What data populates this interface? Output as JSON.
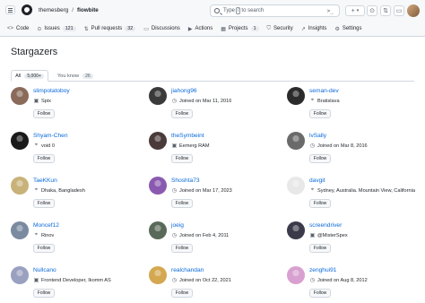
{
  "header": {
    "owner": "themesberg",
    "separator": "/",
    "repo": "flowbite",
    "search_placeholder_prefix": "Type",
    "search_key": "/",
    "search_placeholder_suffix": "to search",
    "command_icon": ">_",
    "plus_label": "+",
    "caret_label": "▾"
  },
  "tabs": [
    {
      "icon": "<>",
      "label": "Code",
      "count": ""
    },
    {
      "icon": "⊙",
      "label": "Issues",
      "count": "121"
    },
    {
      "icon": "⇅",
      "label": "Pull requests",
      "count": "32"
    },
    {
      "icon": "▭",
      "label": "Discussions",
      "count": ""
    },
    {
      "icon": "▶",
      "label": "Actions",
      "count": ""
    },
    {
      "icon": "▦",
      "label": "Projects",
      "count": "1"
    },
    {
      "icon": "⛉",
      "label": "Security",
      "count": ""
    },
    {
      "icon": "↗",
      "label": "Insights",
      "count": ""
    },
    {
      "icon": "⚙",
      "label": "Settings",
      "count": ""
    }
  ],
  "page": {
    "title": "Stargazers",
    "tab_all": "All",
    "tab_all_count": "5,000+",
    "tab_known": "You know",
    "tab_known_count": "26",
    "follow_label": "Follow"
  },
  "users": [
    {
      "name": "slimpotatoboy",
      "meta_icon": "▣",
      "meta": "Spix",
      "color": "#8a6a5a"
    },
    {
      "name": "jiahong96",
      "meta_icon": "◷",
      "meta": "Joined on Mar 11, 2016",
      "color": "#3a3a3a"
    },
    {
      "name": "seman-dev",
      "meta_icon": "⌖",
      "meta": "Bratislava",
      "color": "#2b2b2b"
    },
    {
      "name": "Shyam-Chen",
      "meta_icon": "⌖",
      "meta": "void 0",
      "color": "#1a1a1a"
    },
    {
      "name": "theSymbeint",
      "meta_icon": "▣",
      "meta": "Eemerg RAM",
      "color": "#4a3a3a"
    },
    {
      "name": "lvSally",
      "meta_icon": "◷",
      "meta": "Joined on Mar 8, 2016",
      "color": "#6a6a6a"
    },
    {
      "name": "TaeKKun",
      "meta_icon": "⌖",
      "meta": "Dhaka, Bangladesh",
      "color": "#c8b27a"
    },
    {
      "name": "Shoshta73",
      "meta_icon": "◷",
      "meta": "Joined on Mar 17, 2023",
      "color": "#8a5ab0"
    },
    {
      "name": "davgit",
      "meta_icon": "⌖",
      "meta": "Sydney, Australia. Mountain View, California",
      "color": "#e8e8e8"
    },
    {
      "name": "Moncef12",
      "meta_icon": "⌖",
      "meta": "Rinov",
      "color": "#7a8aa0"
    },
    {
      "name": "joeig",
      "meta_icon": "◷",
      "meta": "Joined on Feb 4, 2011",
      "color": "#5a6a5a"
    },
    {
      "name": "screendriver",
      "meta_icon": "▣",
      "meta": "@MisterSpex",
      "color": "#3a3a4a"
    },
    {
      "name": "Nullcano",
      "meta_icon": "▣",
      "meta": "Frontend Developer, Ikomm AS",
      "color": "#9aa0c0"
    },
    {
      "name": "realchandan",
      "meta_icon": "◷",
      "meta": "Joined on Oct 22, 2021",
      "color": "#d4a850"
    },
    {
      "name": "zenghui91",
      "meta_icon": "◷",
      "meta": "Joined on Aug 8, 2012",
      "color": "#d8a0d0"
    }
  ]
}
